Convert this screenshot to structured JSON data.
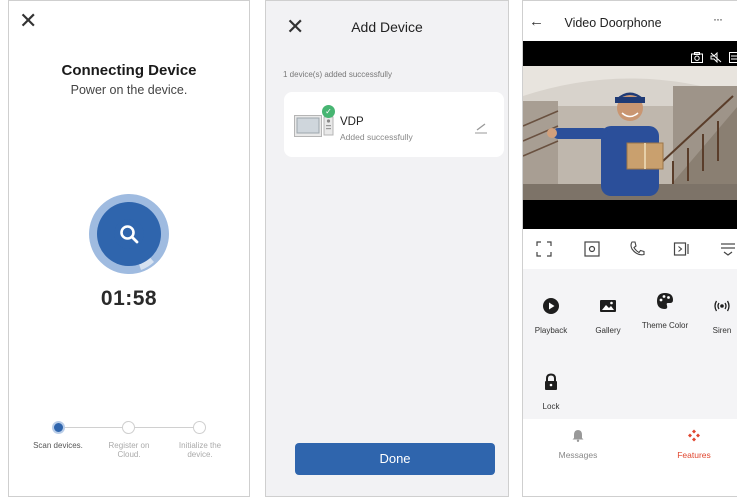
{
  "connecting": {
    "close": "✕",
    "title": "Connecting Device",
    "subtitle": "Power on the device.",
    "timer": "01:58",
    "steps": [
      {
        "label": "Scan devices.",
        "state": "active"
      },
      {
        "label": "Register on Cloud.",
        "state": "pending"
      },
      {
        "label": "Initialize the device.",
        "state": "pending"
      }
    ]
  },
  "add_device": {
    "close": "✕",
    "title": "Add Device",
    "added_count": "1 device(s) added successfully",
    "device": {
      "name": "VDP",
      "status": "Added successfully",
      "badge": "✓"
    },
    "done_label": "Done"
  },
  "doorphone": {
    "back": "←",
    "title": "Video Doorphone",
    "more": "···",
    "video_icons": [
      "camera-icon",
      "mute-icon",
      "menu-icon"
    ],
    "controls": [
      "fullscreen-icon",
      "snapshot-icon",
      "call-icon",
      "record-icon",
      "more-controls-icon"
    ],
    "features": [
      {
        "label": "Playback",
        "icon": "play-icon"
      },
      {
        "label": "Gallery",
        "icon": "gallery-icon"
      },
      {
        "label": "Theme Color",
        "icon": "palette-icon"
      },
      {
        "label": "Siren",
        "icon": "siren-icon"
      },
      {
        "label": "Lock",
        "icon": "lock-icon"
      }
    ],
    "nav": [
      {
        "label": "Messages",
        "icon": "bell-icon",
        "active": false
      },
      {
        "label": "Features",
        "icon": "features-icon",
        "active": true
      }
    ]
  },
  "colors": {
    "accent": "#2f65ad",
    "success": "#47b572",
    "nav_active": "#e0462f"
  }
}
